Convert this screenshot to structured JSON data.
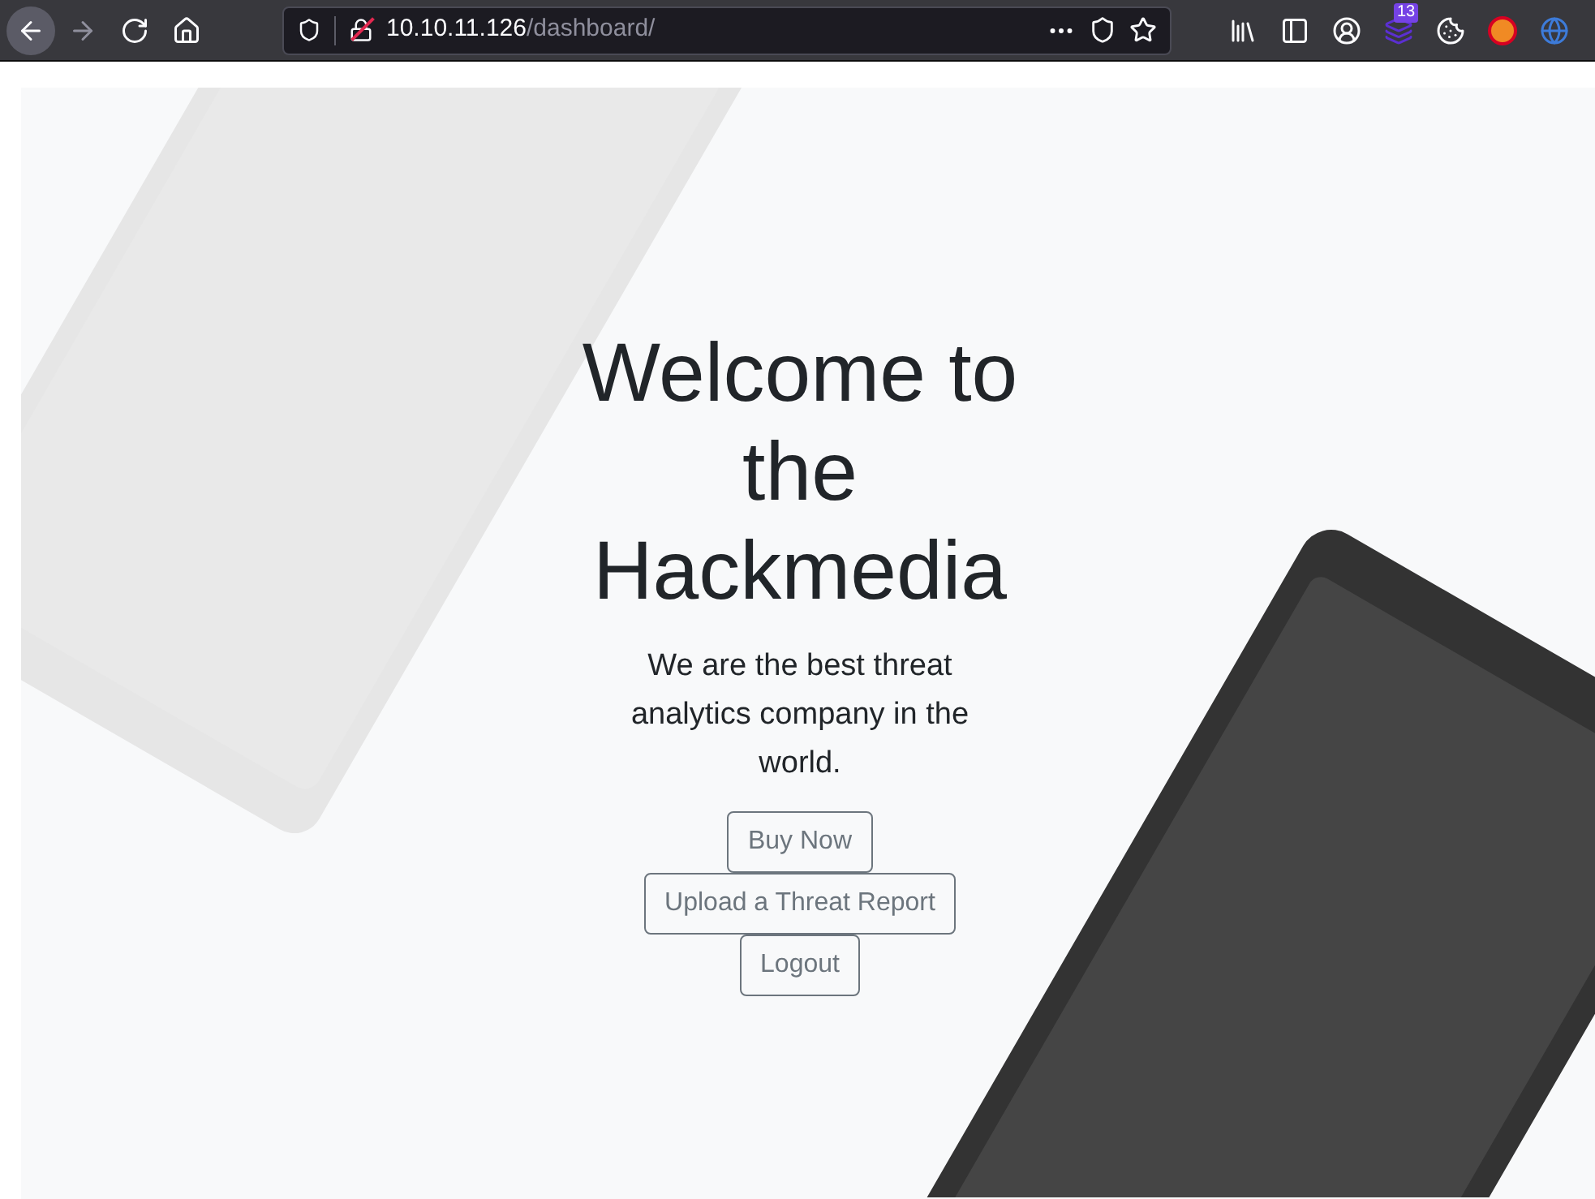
{
  "browser": {
    "nav": [
      {
        "kind": "back",
        "disabled": false
      },
      {
        "kind": "forward",
        "disabled": true
      },
      {
        "kind": "reload",
        "disabled": false
      },
      {
        "kind": "home",
        "disabled": false
      }
    ],
    "url": {
      "host": "10.10.11.126",
      "path": "/dashboard/"
    },
    "extension_badge": "13"
  },
  "hero": {
    "title": "Welcome to the Hackmedia",
    "subtitle": "We are the best threat analytics company in the world.",
    "buttons": [
      "Buy Now",
      "Upload a Threat Report",
      "Logout"
    ]
  }
}
